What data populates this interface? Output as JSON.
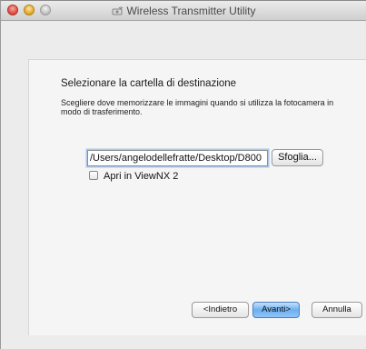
{
  "window": {
    "title": "Wireless Transmitter Utility",
    "title_icon": "wireless-transmitter-icon"
  },
  "main": {
    "heading": "Selezionare la cartella di destinazione",
    "description": "Scegliere dove memorizzare le immagini quando si utilizza la fotocamera in modo di trasferimento.",
    "path_value": "/Users/angelodellefratte/Desktop/D800",
    "browse_label": "Sfoglia...",
    "checkbox_label": "Apri in ViewNX 2",
    "checkbox_checked": false
  },
  "footer": {
    "back_label": "<Indietro",
    "next_label": "Avanti>",
    "cancel_label": "Annulla"
  }
}
